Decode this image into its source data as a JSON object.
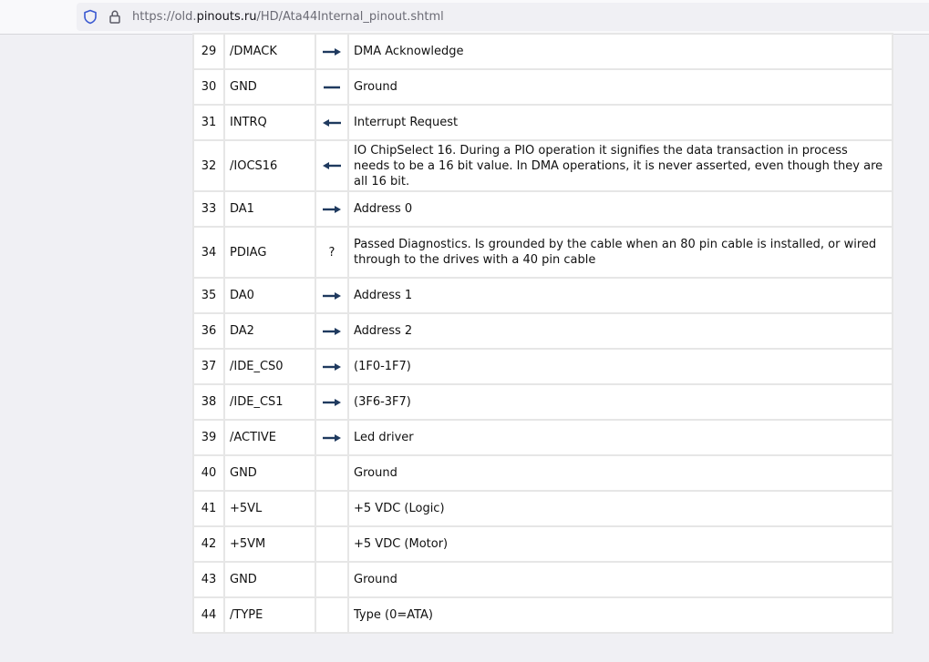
{
  "browser": {
    "url_prefix": "https://old.",
    "url_host": "pinouts.ru",
    "url_path": "/HD/Ata44Internal_pinout.shtml"
  },
  "colors": {
    "arrow": "#1f3a5f"
  },
  "pins": [
    {
      "num": "29",
      "name": "/DMACK",
      "dir": "out",
      "desc": "DMA Acknowledge"
    },
    {
      "num": "30",
      "name": "GND",
      "dir": "line",
      "desc": "Ground"
    },
    {
      "num": "31",
      "name": "INTRQ",
      "dir": "in",
      "desc": "Interrupt Request"
    },
    {
      "num": "32",
      "name": "/IOCS16",
      "dir": "in",
      "desc": "IO ChipSelect 16. During a PIO operation it signifies the data transaction in process needs to be a 16 bit value.  In DMA operations, it is never asserted, even though they are all 16 bit.",
      "tall": true
    },
    {
      "num": "33",
      "name": "DA1",
      "dir": "out",
      "desc": "Address 0"
    },
    {
      "num": "34",
      "name": "PDIAG",
      "dir": "?",
      "desc": "Passed Diagnostics. Is grounded by the cable when an 80 pin cable is installed, or wired through to the drives with a 40 pin cable",
      "tall": true
    },
    {
      "num": "35",
      "name": "DA0",
      "dir": "out",
      "desc": "Address 1"
    },
    {
      "num": "36",
      "name": "DA2",
      "dir": "out",
      "desc": "Address 2"
    },
    {
      "num": "37",
      "name": "/IDE_CS0",
      "dir": "out",
      "desc": "(1F0-1F7)"
    },
    {
      "num": "38",
      "name": "/IDE_CS1",
      "dir": "out",
      "desc": "(3F6-3F7)"
    },
    {
      "num": "39",
      "name": "/ACTIVE",
      "dir": "out",
      "desc": "Led driver"
    },
    {
      "num": "40",
      "name": "GND",
      "dir": "",
      "desc": "Ground"
    },
    {
      "num": "41",
      "name": "+5VL",
      "dir": "",
      "desc": "+5 VDC (Logic)"
    },
    {
      "num": "42",
      "name": "+5VM",
      "dir": "",
      "desc": "+5 VDC (Motor)"
    },
    {
      "num": "43",
      "name": "GND",
      "dir": "",
      "desc": "Ground"
    },
    {
      "num": "44",
      "name": "/TYPE",
      "dir": "",
      "desc": "Type (0=ATA)"
    }
  ]
}
